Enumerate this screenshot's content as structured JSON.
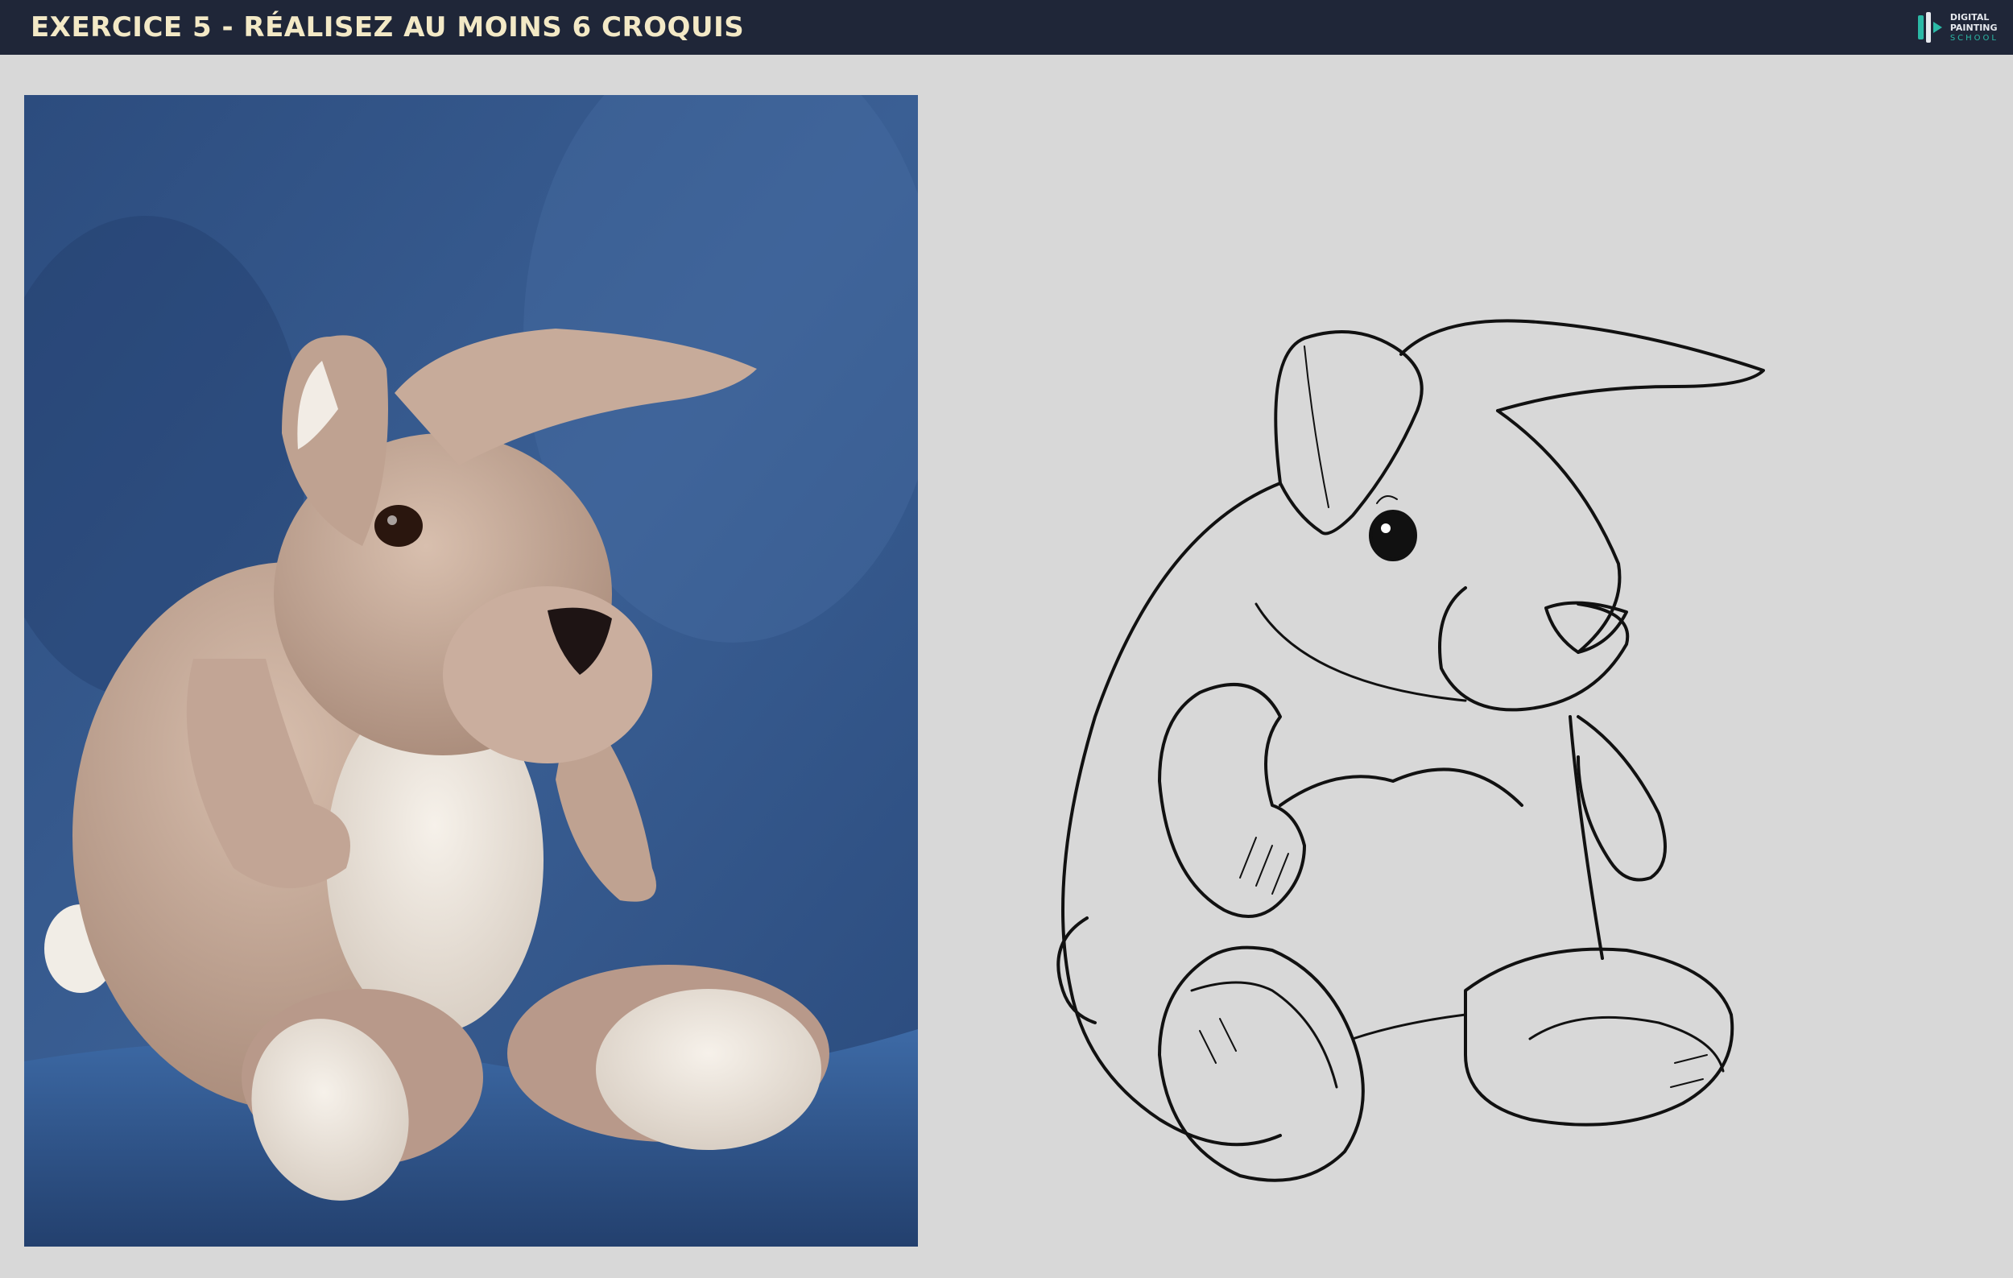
{
  "header": {
    "title": "EXERCICE 5 - RÉALISEZ AU MOINS 6 CROQUIS",
    "logo_line1": "DIGITAL",
    "logo_line2": "PAINTING",
    "logo_line3": "SCHOOL"
  },
  "colors": {
    "header_bg": "#1f2638",
    "title": "#f3e9c6",
    "background": "#d8d8d8",
    "photo_backdrop": "#2c4f84",
    "plush_tan": "#c4a796",
    "plush_cream": "#efe7dd",
    "sketch_line": "#111111",
    "logo_accent": "#2bb9a6"
  },
  "images": {
    "reference": "photo-plush-rabbit-on-blue-blanket",
    "sketch": "line-drawing-plush-rabbit"
  }
}
